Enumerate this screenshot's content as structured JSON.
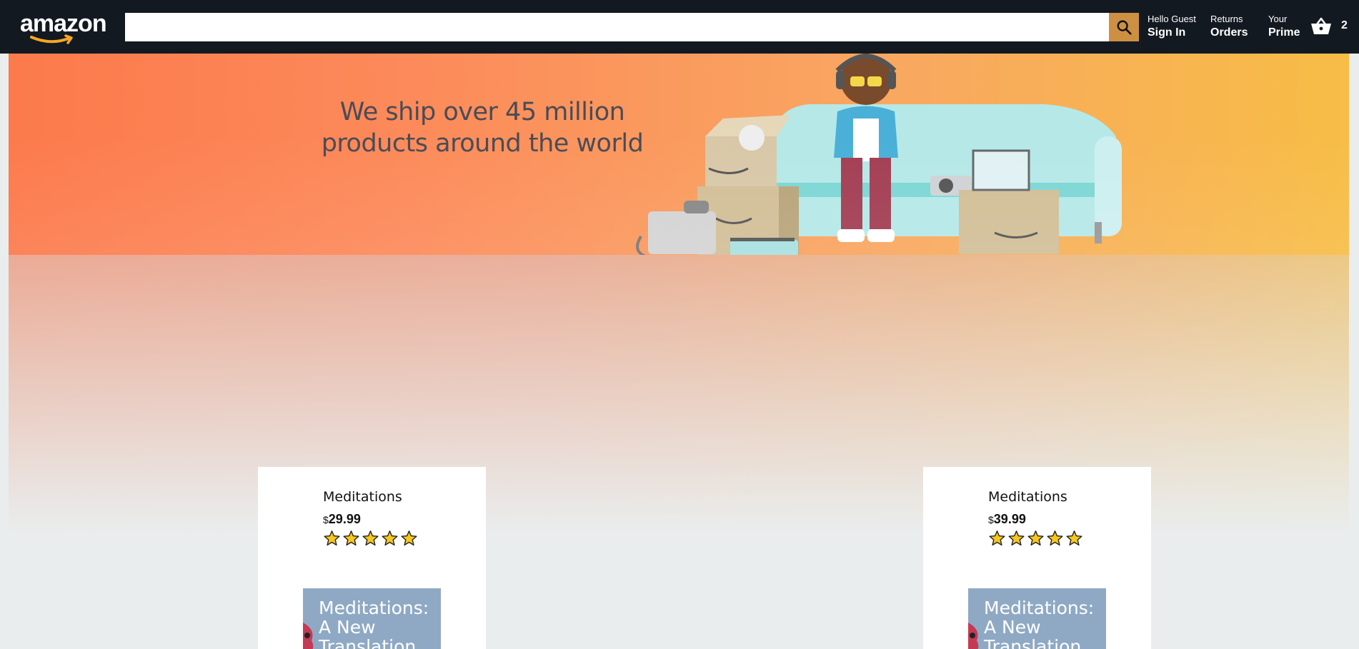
{
  "header": {
    "logo_text": "amazon",
    "search": {
      "value": "",
      "placeholder": ""
    },
    "nav": [
      {
        "line1": "Hello Guest",
        "line2": "Sign In"
      },
      {
        "line1": "Returns",
        "line2": "Orders"
      },
      {
        "line1": "Your",
        "line2": "Prime"
      }
    ],
    "basket_count": "2"
  },
  "hero": {
    "headline_line1": "We ship over 45 million",
    "headline_line2": "products around the world"
  },
  "products": [
    {
      "title": "Meditations",
      "currency": "$",
      "price": "29.99",
      "rating": 5,
      "cover_text": "Meditations:\nA New\nTranslation"
    },
    {
      "title": "Meditations",
      "currency": "$",
      "price": "39.99",
      "rating": 5,
      "cover_text": "Meditations:\nA New\nTranslation"
    }
  ],
  "colors": {
    "header_bg": "#131921",
    "search_button": "#cd9042",
    "star": "#f7c71c"
  }
}
